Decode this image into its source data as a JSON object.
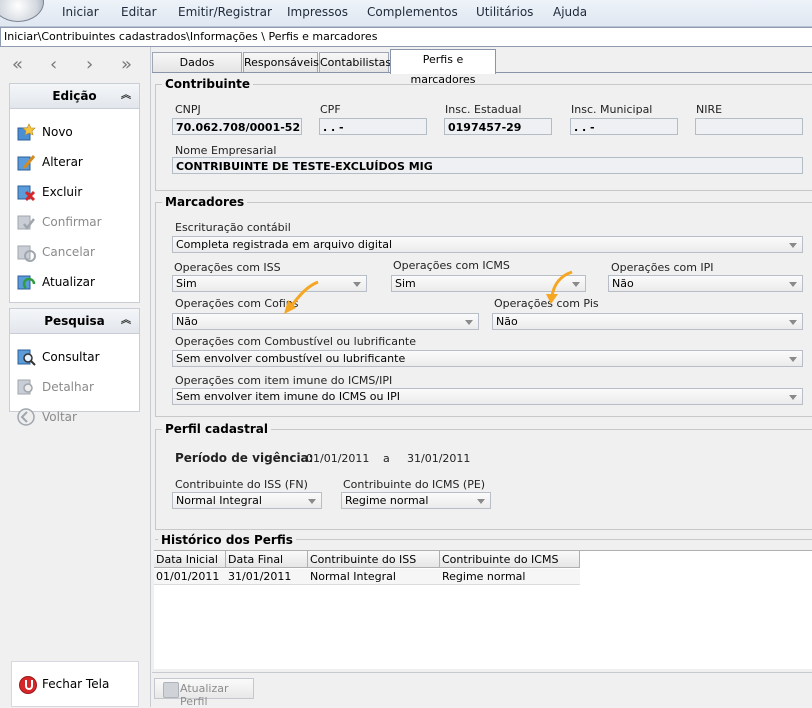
{
  "menu": [
    "Iniciar",
    "Editar",
    "Emitir/Registrar",
    "Impressos",
    "Complementos",
    "Utilitários",
    "Ajuda"
  ],
  "breadcrumb": "Iniciar\\Contribuintes cadastrados\\Informações \\ Perfis e marcadores",
  "nav": {
    "first": "«",
    "prev": "‹",
    "next": "›",
    "last": "»"
  },
  "edicao": {
    "title": "Edição",
    "items": [
      {
        "label": "Novo",
        "icon": "new-icon",
        "enabled": true
      },
      {
        "label": "Alterar",
        "icon": "edit-icon",
        "enabled": true
      },
      {
        "label": "Excluir",
        "icon": "delete-icon",
        "enabled": true
      },
      {
        "label": "Confirmar",
        "icon": "confirm-icon",
        "enabled": false
      },
      {
        "label": "Cancelar",
        "icon": "cancel-icon",
        "enabled": false
      },
      {
        "label": "Atualizar",
        "icon": "refresh-icon",
        "enabled": true
      }
    ]
  },
  "pesquisa": {
    "title": "Pesquisa",
    "items": [
      {
        "label": "Consultar",
        "icon": "search-icon",
        "enabled": true
      },
      {
        "label": "Detalhar",
        "icon": "detail-icon",
        "enabled": false
      },
      {
        "label": "Voltar",
        "icon": "back-icon",
        "enabled": false
      }
    ]
  },
  "close_label": "Fechar Tela",
  "tabs": [
    "Dados cadastrais",
    "Responsáveis",
    "Contabilistas",
    "Perfis e marcadores"
  ],
  "contribuinte": {
    "title": "Contribuinte",
    "cnpj_label": "CNPJ",
    "cnpj": "70.062.708/0001-52",
    "cpf_label": "CPF",
    "cpf": " .  .  -",
    "ie_label": "Insc. Estadual",
    "ie": "0197457-29",
    "im_label": "Insc. Municipal",
    "im": " .  .  -",
    "nire_label": "NIRE",
    "nire": "",
    "nome_label": "Nome Empresarial",
    "nome": "CONTRIBUINTE DE TESTE-EXCLUÍDOS MIG"
  },
  "marcadores": {
    "title": "Marcadores",
    "escrituracao_label": "Escrituração contábil",
    "escrituracao": "Completa registrada em arquivo digital",
    "iss_label": "Operações com ISS",
    "iss": "Sim",
    "icms_label": "Operações com ICMS",
    "icms": "Sim",
    "ipi_label": "Operações com IPI",
    "ipi": "Não",
    "cofins_label": "Operações com Cofins",
    "cofins": "Não",
    "pis_label": "Operações com Pis",
    "pis": "Não",
    "combustivel_label": "Operações com Combustível ou lubrificante",
    "combustivel": "Sem envolver combustível ou lubrificante",
    "imune_label": "Operações com item imune do ICMS/IPI",
    "imune": "Sem envolver item imune do ICMS ou IPI"
  },
  "perfil": {
    "title": "Perfil cadastral",
    "periodo_label": "Período de vigência:",
    "inicio": "01/01/2011",
    "sep": "a",
    "fim": "31/01/2011",
    "iss_label": "Contribuinte do ISS (FN)",
    "iss": "Normal Integral",
    "icms_label": "Contribuinte do ICMS (PE)",
    "icms": "Regime normal"
  },
  "historico": {
    "title": "Histórico dos Perfis",
    "columns": [
      "Data Inicial",
      "Data Final",
      "Contribuinte do ISS (FN)",
      "Contribuinte do ICMS (PE)"
    ],
    "rows": [
      [
        "01/01/2011",
        "31/01/2011",
        "Normal Integral",
        "Regime normal"
      ]
    ]
  },
  "update_button": "Atualizar Perfil",
  "colors": {
    "accent": "#f5a623",
    "delete": "#d7262a"
  }
}
